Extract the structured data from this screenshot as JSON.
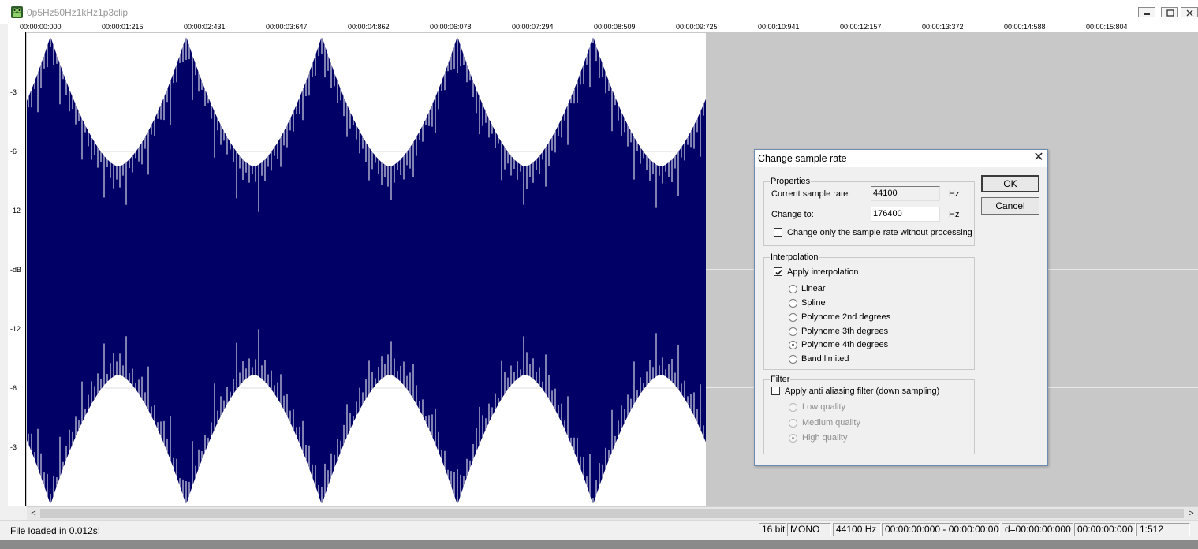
{
  "window": {
    "title": "0p5Hz50Hz1kHz1p3clip"
  },
  "ruler": {
    "labels": [
      "00:00:00:000",
      "00:00:01:215",
      "00:00:02:431",
      "00:00:03:647",
      "00:00:04:862",
      "00:00:06:078",
      "00:00:07:294",
      "00:00:08:509",
      "00:00:09:725",
      "00:00:10:941",
      "00:00:12:157",
      "00:00:13:372",
      "00:00:14:588",
      "00:00:15:804"
    ]
  },
  "db_scale": {
    "labels": [
      "-3",
      "-6",
      "-12",
      "-dB",
      "-12",
      "-6",
      "-3"
    ]
  },
  "colors": {
    "waveform": "#000066",
    "background": "#c8c8c8"
  },
  "status": {
    "message": "File loaded in 0.012s!",
    "bit_depth": "16 bit",
    "channels": "MONO",
    "sample_rate": "44100 Hz",
    "selection": "00:00:00:000 - 00:00:00:000",
    "duration": "d=00:00:00:000",
    "position": "00:00:00:000",
    "zoom": "1:512"
  },
  "dialog": {
    "title": "Change sample rate",
    "properties": {
      "legend": "Properties",
      "current_label": "Current sample rate:",
      "current_value": "44100",
      "current_unit": "Hz",
      "change_label": "Change to:",
      "change_value": "176400",
      "change_unit": "Hz",
      "only_rate_label": "Change only the sample rate without processing",
      "only_rate_checked": false
    },
    "interpolation": {
      "legend": "Interpolation",
      "apply_label": "Apply interpolation",
      "apply_checked": true,
      "options": [
        "Linear",
        "Spline",
        "Polynome 2nd degrees",
        "Polynome 3th degrees",
        "Polynome 4th degrees",
        "Band limited"
      ],
      "selected": "Polynome 4th degrees"
    },
    "filter": {
      "legend": "Filter",
      "apply_label": "Apply anti aliasing filter (down sampling)",
      "apply_checked": false,
      "options": [
        "Low quality",
        "Medium quality",
        "High quality"
      ],
      "selected": "High quality"
    },
    "ok_label": "OK",
    "cancel_label": "Cancel"
  }
}
